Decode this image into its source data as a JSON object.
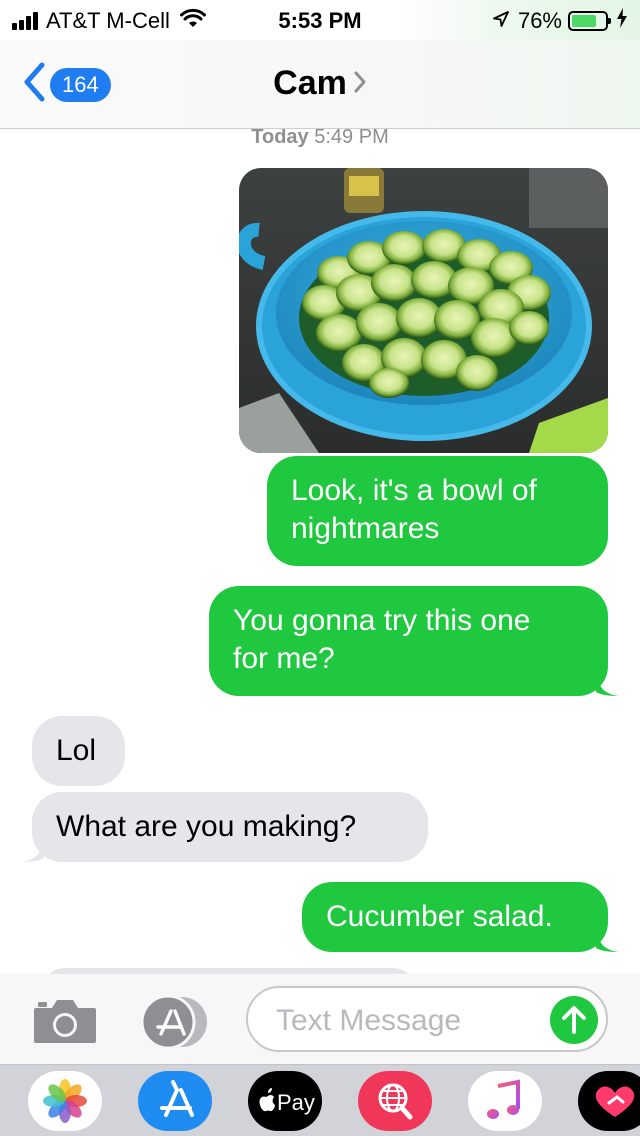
{
  "status_bar": {
    "carrier": "AT&T M-Cell",
    "time": "5:53 PM",
    "battery_percent": "76%",
    "battery_level": 0.76,
    "icons": [
      "signal-bars-icon",
      "wifi-icon",
      "location-arrow-icon",
      "battery-icon",
      "charging-bolt-icon"
    ]
  },
  "header": {
    "unread_count": "164",
    "contact_name": "Cam"
  },
  "conversation": {
    "timestamp_day": "Today",
    "timestamp_time": "5:49 PM",
    "photo_subject": "bowl-of-sliced-cucumbers",
    "messages": [
      {
        "direction": "sent",
        "lines": [
          "Look, it's a bowl of",
          "nightmares"
        ]
      },
      {
        "direction": "sent",
        "lines": [
          "You gonna try this one",
          "for me?"
        ]
      },
      {
        "direction": "received",
        "lines": [
          "Lol"
        ]
      },
      {
        "direction": "received",
        "lines": [
          "What are you making?"
        ]
      },
      {
        "direction": "sent",
        "lines": [
          "Cucumber salad."
        ]
      }
    ]
  },
  "input_bar": {
    "placeholder": "Text Message",
    "icons": [
      "camera-icon",
      "app-store-icon",
      "send-arrow-icon"
    ]
  },
  "app_drawer": {
    "apps": [
      {
        "name": "photos",
        "icon": "photos-icon"
      },
      {
        "name": "app-store",
        "icon": "app-store-icon"
      },
      {
        "name": "apple-pay",
        "icon": "apple-pay-icon",
        "label": "Pay"
      },
      {
        "name": "images-search",
        "icon": "globe-search-icon"
      },
      {
        "name": "music",
        "icon": "music-note-icon"
      },
      {
        "name": "digital-touch",
        "icon": "heart-touch-icon"
      }
    ]
  },
  "colors": {
    "sent_bubble": "#1fc83f",
    "received_bubble": "#e6e5ea",
    "link_blue": "#1f7cf1",
    "bowl_blue": "#2aa3d9",
    "battery_green": "#4cd964"
  }
}
